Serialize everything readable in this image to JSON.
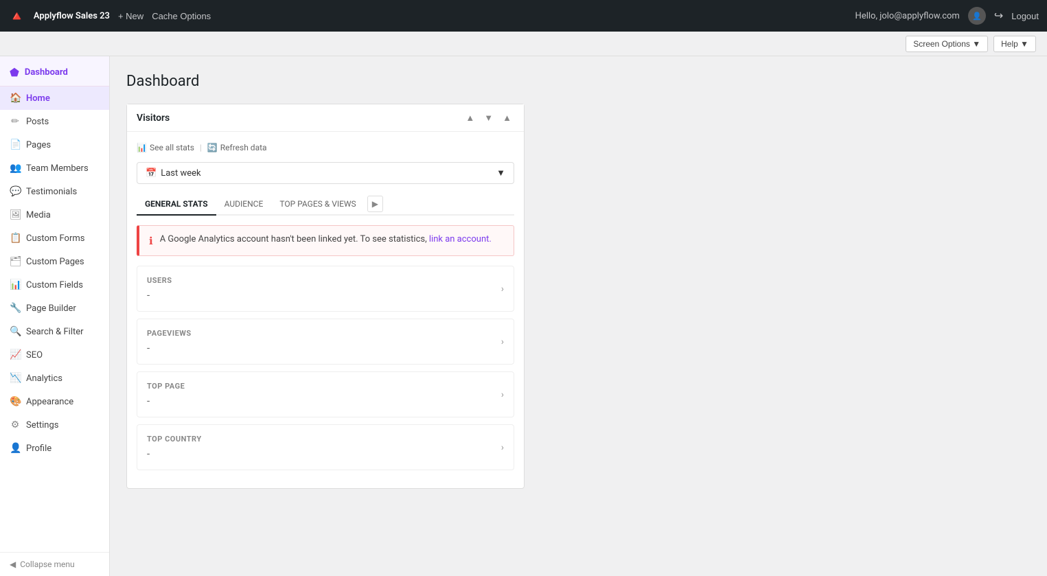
{
  "app": {
    "name": "Applyflow Sales 23",
    "logo": "🔺"
  },
  "topbar": {
    "new_label": "+ New",
    "cache_options_label": "Cache Options",
    "user_greeting": "Hello, jolo@applyflow.com",
    "logout_label": "Logout",
    "screen_options_label": "Screen Options ▼",
    "help_label": "Help ▼"
  },
  "sidebar": {
    "header_label": "Dashboard",
    "home_label": "Home",
    "items": [
      {
        "id": "posts",
        "label": "Posts",
        "icon": "📝"
      },
      {
        "id": "pages",
        "label": "Pages",
        "icon": "📄"
      },
      {
        "id": "team-members",
        "label": "Team Members",
        "icon": "👥"
      },
      {
        "id": "testimonials",
        "label": "Testimonials",
        "icon": "💬"
      },
      {
        "id": "media",
        "label": "Media",
        "icon": "🖼"
      },
      {
        "id": "custom-forms",
        "label": "Custom Forms",
        "icon": "📋"
      },
      {
        "id": "custom-pages",
        "label": "Custom Pages",
        "icon": "🗂"
      },
      {
        "id": "custom-fields",
        "label": "Custom Fields",
        "icon": "📊"
      },
      {
        "id": "page-builder",
        "label": "Page Builder",
        "icon": "🔧"
      },
      {
        "id": "search-filter",
        "label": "Search & Filter",
        "icon": "🔍"
      },
      {
        "id": "seo",
        "label": "SEO",
        "icon": "📈"
      },
      {
        "id": "analytics",
        "label": "Analytics",
        "icon": "📉"
      },
      {
        "id": "appearance",
        "label": "Appearance",
        "icon": "🎨"
      },
      {
        "id": "settings",
        "label": "Settings",
        "icon": "⚙"
      },
      {
        "id": "profile",
        "label": "Profile",
        "icon": "👤"
      }
    ],
    "collapse_label": "Collapse menu"
  },
  "page": {
    "title": "Dashboard"
  },
  "widget": {
    "title": "Visitors",
    "see_all_stats": "See all stats",
    "refresh_data": "Refresh data",
    "date_period": "Last week",
    "tabs": [
      {
        "id": "general-stats",
        "label": "GENERAL STATS",
        "active": true
      },
      {
        "id": "audience",
        "label": "AUDIENCE",
        "active": false
      },
      {
        "id": "top-pages-views",
        "label": "TOP PAGES & VIEWS",
        "active": false
      }
    ],
    "alert_message": "A Google Analytics account hasn't been linked yet. To see statistics,",
    "alert_link_label": "link an account.",
    "stats": [
      {
        "id": "users",
        "label": "USERS",
        "value": "-"
      },
      {
        "id": "pageviews",
        "label": "PAGEVIEWS",
        "value": "-"
      },
      {
        "id": "top-page",
        "label": "TOP PAGE",
        "value": "-"
      },
      {
        "id": "top-country",
        "label": "TOP COUNTRY",
        "value": "-"
      }
    ]
  }
}
